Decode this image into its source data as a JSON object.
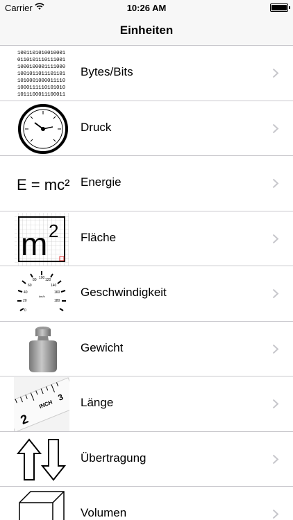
{
  "status_bar": {
    "carrier": "Carrier",
    "time": "10:26 AM"
  },
  "nav": {
    "title": "Einheiten"
  },
  "items": [
    {
      "label": "Bytes/Bits",
      "icon": "binary-digits-icon"
    },
    {
      "label": "Druck",
      "icon": "pressure-gauge-icon"
    },
    {
      "label": "Energie",
      "icon": "energy-formula-icon"
    },
    {
      "label": "Fläche",
      "icon": "area-grid-icon"
    },
    {
      "label": "Geschwindigkeit",
      "icon": "speedometer-icon"
    },
    {
      "label": "Gewicht",
      "icon": "weight-icon"
    },
    {
      "label": "Länge",
      "icon": "measuring-tape-icon"
    },
    {
      "label": "Übertragung",
      "icon": "up-down-arrows-icon"
    },
    {
      "label": "Volumen",
      "icon": "cube-icon"
    }
  ],
  "thumb_text": {
    "binary": [
      "1001101010010001",
      "0110101110111001",
      "1000100001111000",
      "1001011011101101",
      "1010001000011110",
      "1000111110101010",
      "1011100011100011"
    ],
    "energy": "E = mc²",
    "area_main": "m",
    "area_sup": "2",
    "tape": "INCH"
  }
}
